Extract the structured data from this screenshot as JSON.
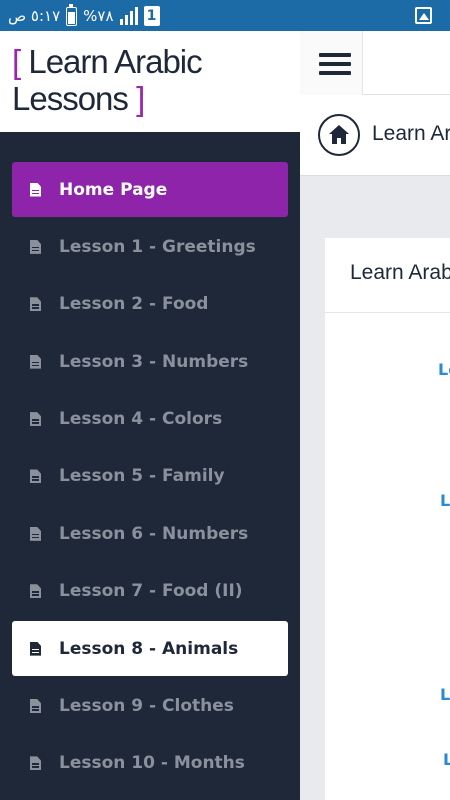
{
  "status_bar": {
    "time": "٥:١٧ ص",
    "battery_percent": "%٧٨",
    "sim_slot": "1"
  },
  "brand": {
    "line1": "Learn Arabic",
    "line2": "Lessons",
    "bracket_open": "[",
    "bracket_close": "]",
    "accent_color": "#9b27b0"
  },
  "sidebar": {
    "items": [
      {
        "label": "Home Page",
        "icon": "document-icon",
        "state": "active-purple"
      },
      {
        "label": "Lesson 1 - Greetings",
        "icon": "document-icon",
        "state": ""
      },
      {
        "label": "Lesson 2 - Food",
        "icon": "document-icon",
        "state": ""
      },
      {
        "label": "Lesson 3 - Numbers",
        "icon": "document-icon",
        "state": ""
      },
      {
        "label": "Lesson 4 - Colors",
        "icon": "document-icon",
        "state": ""
      },
      {
        "label": "Lesson 5 - Family",
        "icon": "document-icon",
        "state": ""
      },
      {
        "label": "Lesson 6 - Numbers",
        "icon": "document-icon",
        "state": ""
      },
      {
        "label": "Lesson 7 - Food (II)",
        "icon": "document-icon",
        "state": ""
      },
      {
        "label": "Lesson 8 - Animals",
        "icon": "document-icon",
        "state": "active-white"
      },
      {
        "label": "Lesson 9 - Clothes",
        "icon": "document-icon",
        "state": ""
      },
      {
        "label": "Lesson 10 - Months",
        "icon": "document-icon",
        "state": ""
      }
    ]
  },
  "header": {
    "menu_icon": "hamburger-icon",
    "breadcrumb_icon": "home-icon",
    "breadcrumb_text": "Learn Ar"
  },
  "content": {
    "card_title": "Learn Arabi",
    "links": [
      "Le",
      "L",
      "L",
      "L"
    ]
  },
  "colors": {
    "sidebar_bg": "#1f2838",
    "active_purple": "#8e24aa",
    "link_blue": "#2a8ad4",
    "status_bar": "#1c6aa6"
  }
}
